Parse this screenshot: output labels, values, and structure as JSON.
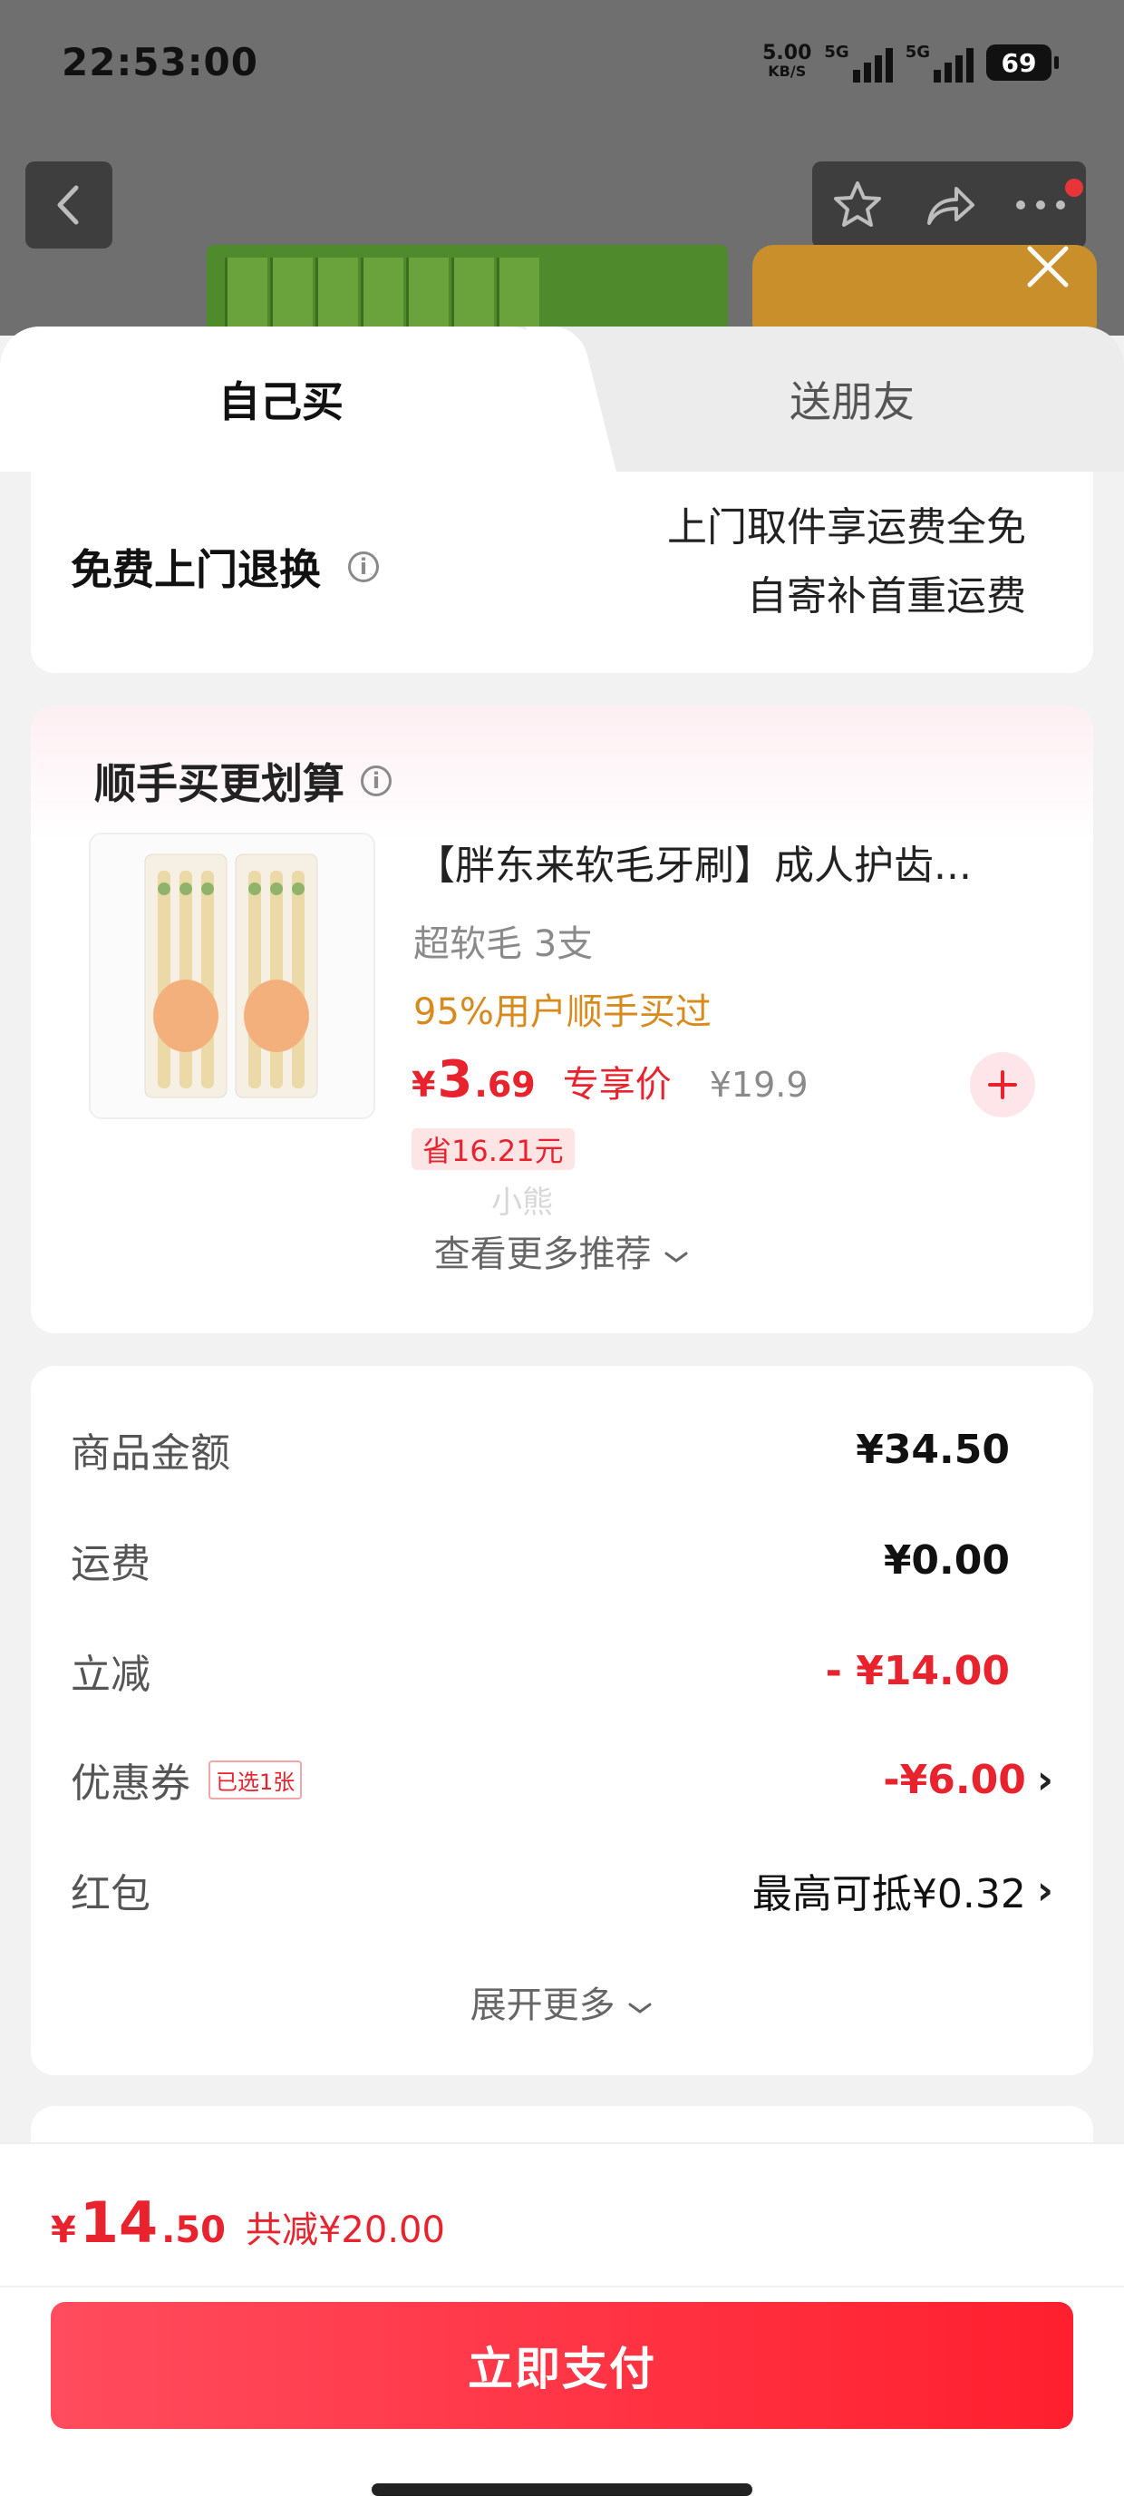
{
  "status_bar": {
    "time": "22:53:00",
    "net_speed": "5.00",
    "net_unit": "KB/S",
    "signal1_label": "5G",
    "signal2_label": "5G",
    "battery": "69"
  },
  "tabs": {
    "self": "自己买",
    "friend": "送朋友"
  },
  "return_service": {
    "title": "免费上门退换",
    "line1": "上门取件享运费全免",
    "line2": "自寄补首重运费"
  },
  "combo": {
    "title": "顺手买更划算",
    "product": {
      "name": "【胖东来软毛牙刷】成人护齿...",
      "spec": "超软毛 3支",
      "tag": "95%用户顺手买过",
      "price_currency": "¥",
      "price_int": "3",
      "price_dec": ".69",
      "price_label": "专享价",
      "original_price": "¥19.9",
      "save": "省16.21元"
    },
    "watermark": "小熊",
    "see_more": "查看更多推荐"
  },
  "summary": {
    "rows": [
      {
        "label": "商品金额",
        "value": "¥34.50"
      },
      {
        "label": "运费",
        "value": "¥0.00"
      },
      {
        "label": "立减",
        "value": "- ¥14.00"
      },
      {
        "label": "优惠券",
        "badge": "已选1张",
        "value": "-¥6.00"
      },
      {
        "label": "红包",
        "value": "最高可抵¥0.32"
      }
    ],
    "expand": "展开更多"
  },
  "footer": {
    "currency": "¥",
    "total_int": "14",
    "total_dec": ".50",
    "total_save": "共减¥20.00",
    "pay_button": "立即支付"
  },
  "colors": {
    "accent": "#e8232d",
    "tag_orange": "#d98a1d",
    "pay_start": "#ff4c5e",
    "pay_end": "#ff1f2e"
  }
}
